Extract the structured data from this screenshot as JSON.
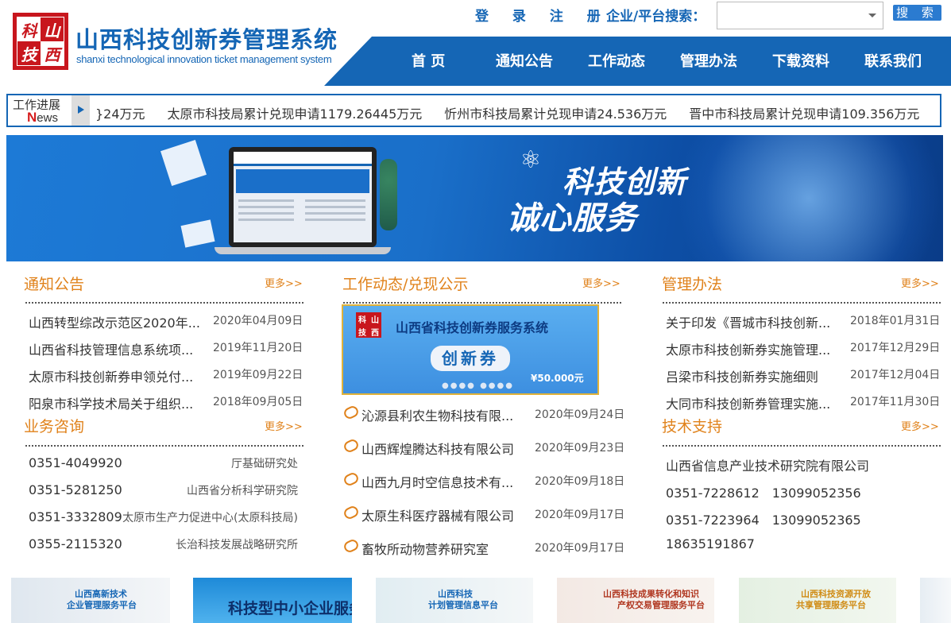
{
  "header": {
    "logo_chars": [
      "山",
      "科",
      "西",
      "技"
    ],
    "title": "山西科技创新券管理系统",
    "subtitle": "shanxi technological innovation ticket management system",
    "login_register": "登 录 注 册",
    "search_label": "企业/平台搜索：",
    "search_value": "",
    "search_button": "搜 索"
  },
  "nav": [
    "首 页",
    "通知公告",
    "工作动态",
    "管理办法",
    "下载资料",
    "联系我们"
  ],
  "ticker": {
    "label_top": "工作进展",
    "label_n": "N",
    "label_rest": "ews",
    "items": [
      "}24万元",
      "太原市科技局累计兑现申请1179.26445万元",
      "忻州市科技局累计兑现申请24.536万元",
      "晋中市科技局累计兑现申请109.356万元"
    ]
  },
  "banner": {
    "slogan_line1": "科技创新",
    "slogan_line2": "诚心服务"
  },
  "notice": {
    "title": "通知公告",
    "more": "更多>>",
    "items": [
      {
        "text": "山西转型综改示范区2020年...",
        "date": "2020年04月09日"
      },
      {
        "text": "山西省科技管理信息系统项...",
        "date": "2019年11月20日"
      },
      {
        "text": "太原市科技创新券申领兑付...",
        "date": "2019年09月22日"
      },
      {
        "text": "阳泉市科学技术局关于组织...",
        "date": "2018年09月05日"
      }
    ]
  },
  "work": {
    "title": "工作动态/兑现公示",
    "more": "更多>>",
    "coupon_title": "山西省科技创新券服务系统",
    "coupon_main": "创新券",
    "coupon_amount": "¥50.000元",
    "items": [
      {
        "text": "沁源县利农生物科技有限...",
        "date": "2020年09月24日"
      },
      {
        "text": "山西辉煌腾达科技有限公司",
        "date": "2020年09月23日"
      },
      {
        "text": "山西九月时空信息技术有...",
        "date": "2020年09月18日"
      },
      {
        "text": "太原生科医疗器械有限公司",
        "date": "2020年09月17日"
      },
      {
        "text": "畜牧所动物营养研究室",
        "date": "2020年09月17日"
      }
    ]
  },
  "rules": {
    "title": "管理办法",
    "more": "更多>>",
    "items": [
      {
        "text": "关于印发《晋城市科技创新...",
        "date": "2018年01月31日"
      },
      {
        "text": "太原市科技创新券实施管理...",
        "date": "2017年12月29日"
      },
      {
        "text": "吕梁市科技创新券实施细则",
        "date": "2017年12月04日"
      },
      {
        "text": "大同市科技创新券管理实施...",
        "date": "2017年11月30日"
      }
    ]
  },
  "consult": {
    "title": "业务咨询",
    "more": "更多>>",
    "items": [
      {
        "phone": "0351-4049920",
        "org": "厅基础研究处"
      },
      {
        "phone": "0351-5281250",
        "org": "山西省分析科学研究院"
      },
      {
        "phone": "0351-3332809",
        "org": "太原市生产力促进中心(太原科技局)"
      },
      {
        "phone": "0355-2115320",
        "org": "长治科技发展战略研究所"
      }
    ]
  },
  "support": {
    "title": "技术支持",
    "more": "更多>>",
    "company": "山西省信息产业技术研究院有限公司",
    "lines": [
      "0351-7228612　13099052356",
      "0351-7223964　13099052365",
      "18635191867"
    ]
  },
  "platforms": [
    {
      "line1": "山西高新技术",
      "line2": "企业管理服务平台"
    },
    {
      "line1": "科技型中小企业服务",
      "line2": ""
    },
    {
      "line1": "山西科技",
      "line2": "计划管理信息平台"
    },
    {
      "line1": "山西科技成果转化和知识",
      "line2": "产权交易管理服务平台"
    },
    {
      "line1": "山西科技资源开放",
      "line2": "共享管理服务平台"
    }
  ],
  "colors": {
    "brand_blue": "#1566b5",
    "accent_orange": "#e0821b",
    "logo_red": "#c8161d"
  }
}
